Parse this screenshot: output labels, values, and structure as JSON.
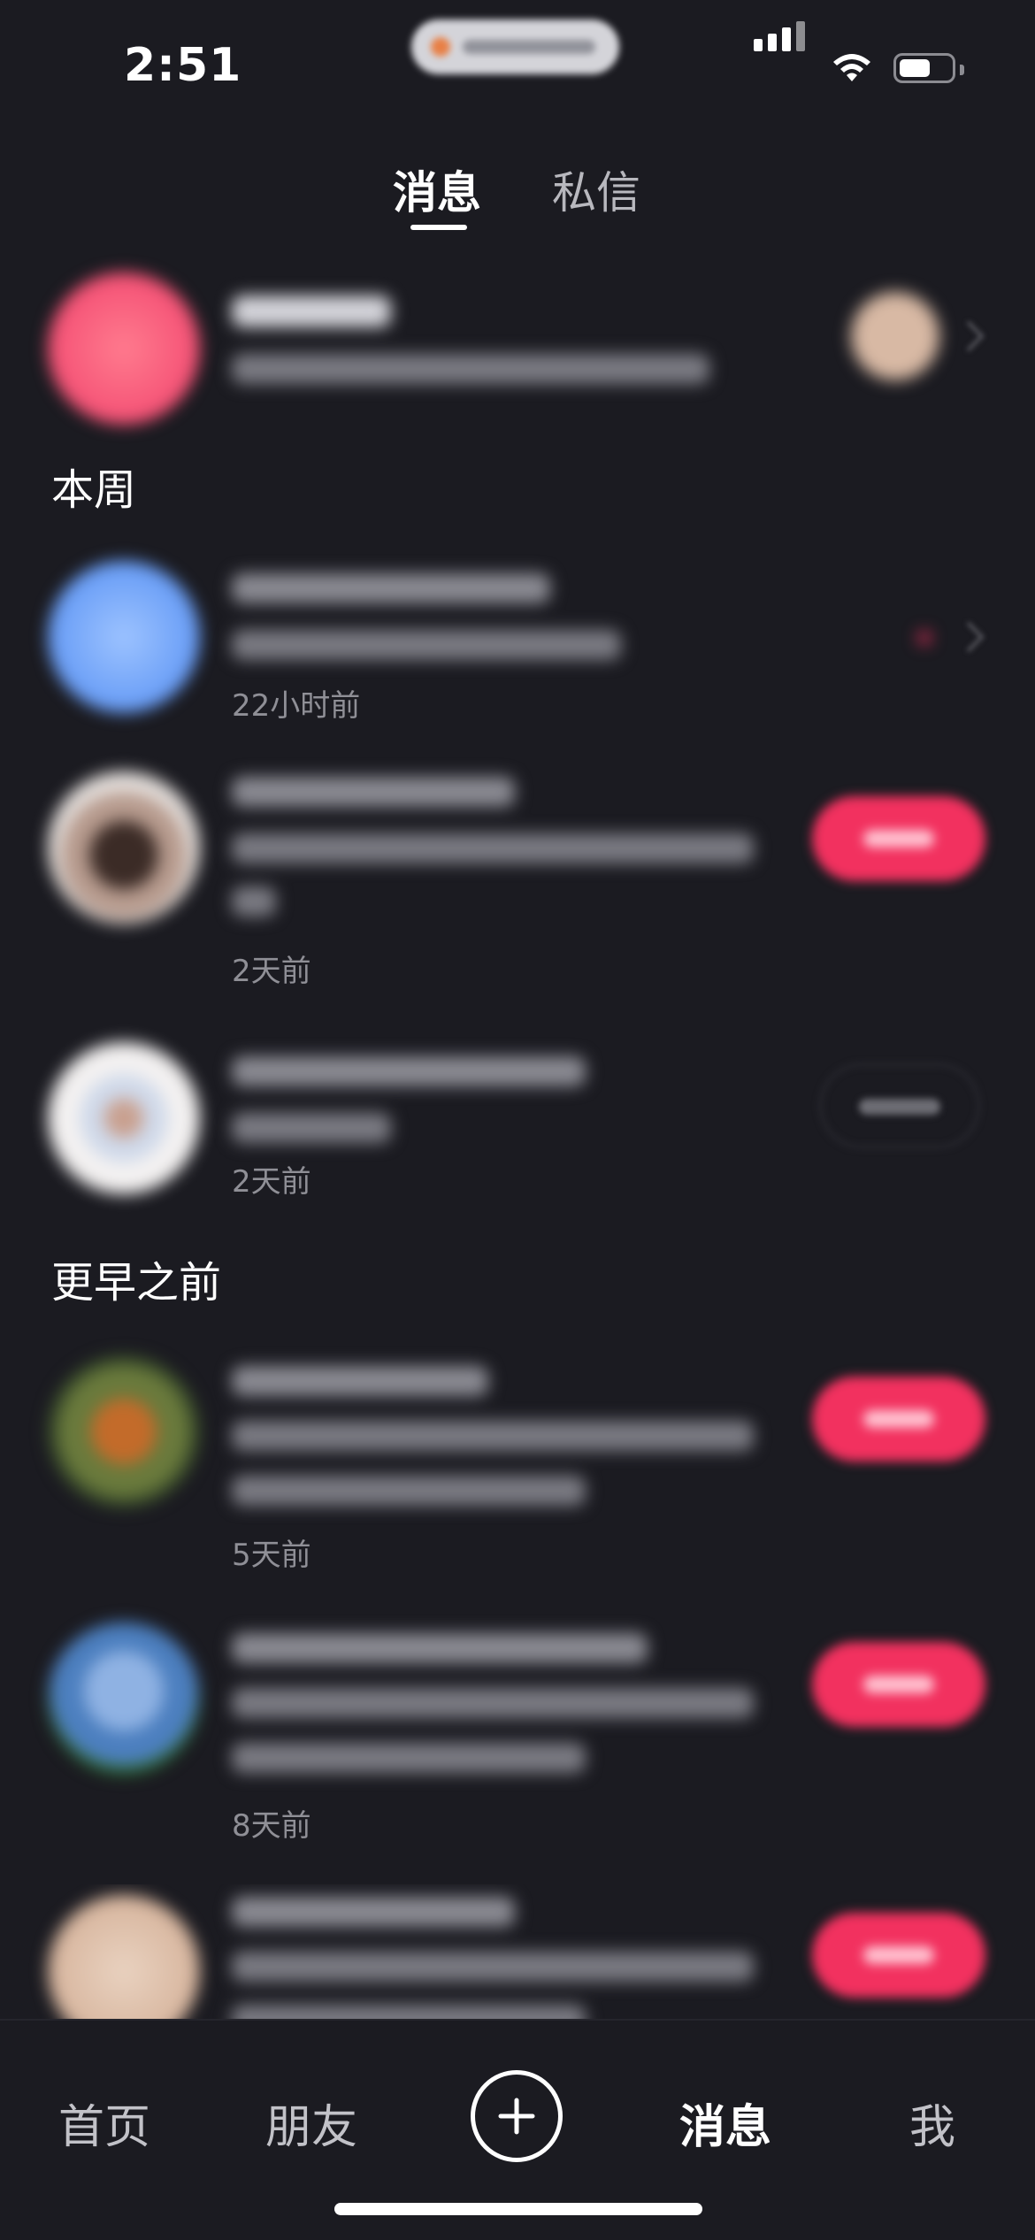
{
  "status_bar": {
    "time": "2:51"
  },
  "top_tabs": {
    "active": "消息",
    "inactive": "私信"
  },
  "sections": {
    "this_week": "本周",
    "earlier": "更早之前"
  },
  "rows": [
    {
      "time": ""
    },
    {
      "time": "22小时前"
    },
    {
      "time": "2天前"
    },
    {
      "time": "2天前"
    },
    {
      "time": "5天前"
    },
    {
      "time": "8天前"
    },
    {
      "time": ""
    }
  ],
  "bottom_nav": {
    "home": "首页",
    "friends": "朋友",
    "messages": "消息",
    "me": "我"
  },
  "colors": {
    "accent": "#f2315f",
    "background": "#1b1b21"
  }
}
